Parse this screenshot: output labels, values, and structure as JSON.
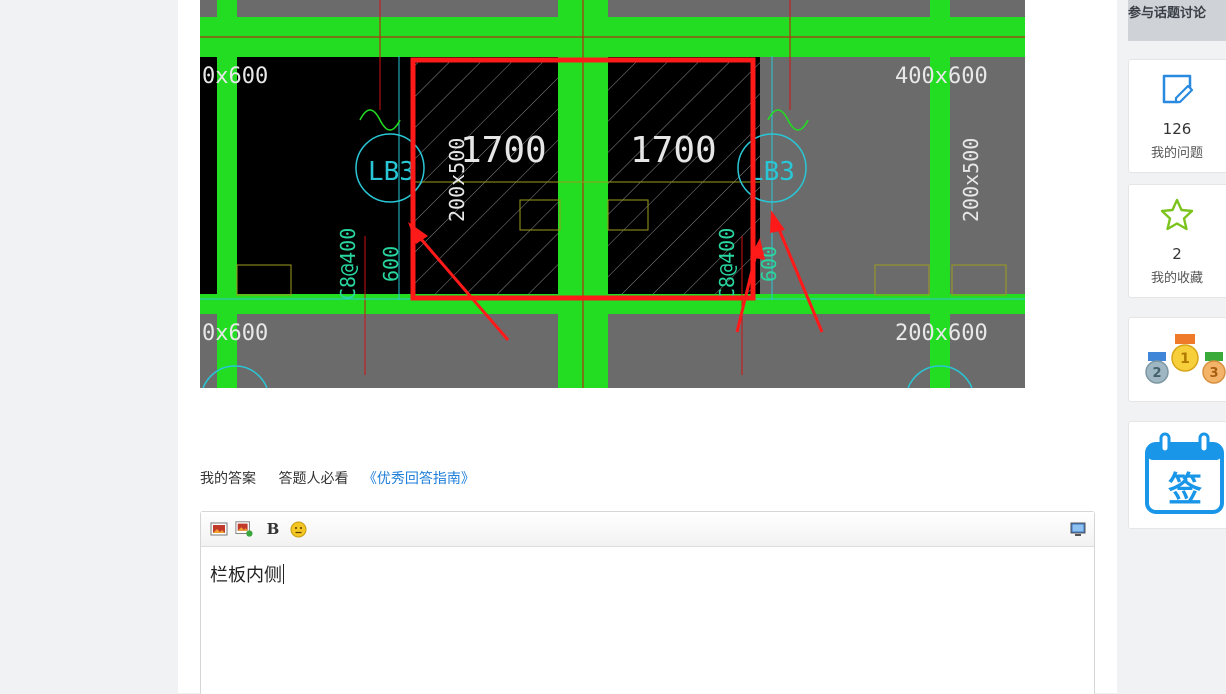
{
  "cad": {
    "top_left_size": "0x600",
    "top_right_size": "400x600",
    "bottom_left_size": "0x600",
    "bottom_right_size": "200x600",
    "left_beam": "200x500",
    "right_beam": "200x500",
    "span_left": "1700",
    "span_right": "1700",
    "label_left": "LB3",
    "label_right": "LB3",
    "rebar_left": "C8@400",
    "rebar_right": "C8@400",
    "dim_left": "600",
    "dim_right": "600",
    "highlight_color": "#ff1a1a",
    "beam_color": "#22dd22"
  },
  "answer": {
    "my_answer": "我的答案",
    "must_read": "答题人必看",
    "guide_link": "《优秀回答指南》",
    "link_color": "#1f7fd8"
  },
  "editor": {
    "content": "栏板内侧",
    "tools": [
      "image-icon",
      "insert-image-icon",
      "bold-icon",
      "emoji-icon",
      "preview-icon"
    ],
    "bold_label": "B"
  },
  "sidebar": {
    "top_banner": "参与话题讨论",
    "questions": {
      "count": "126",
      "label": "我的问题"
    },
    "favorites": {
      "count": "2",
      "label": "我的收藏"
    },
    "ranking_icon": "medals-icon",
    "signin": {
      "label": "签"
    }
  }
}
